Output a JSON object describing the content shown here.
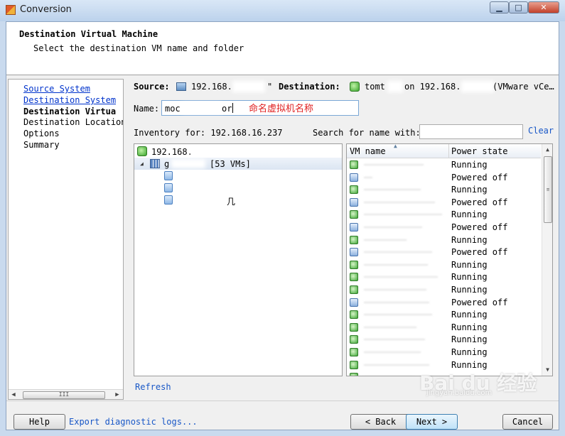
{
  "window": {
    "title": "Conversion",
    "min_glyph": "▁",
    "max_glyph": "□",
    "close_glyph": "✕"
  },
  "header": {
    "title": "Destination Virtual Machine",
    "subtitle": "Select the destination VM name and folder"
  },
  "steps": {
    "items": [
      {
        "label": "Source System",
        "state": "link"
      },
      {
        "label": "Destination System",
        "state": "link"
      },
      {
        "label": "Destination Virtua",
        "state": "current"
      },
      {
        "label": "Destination Location",
        "state": "plain"
      },
      {
        "label": "Options",
        "state": "plain"
      },
      {
        "label": "Summary",
        "state": "plain"
      }
    ],
    "scroll_left": "◀",
    "scroll_right": "▶",
    "scroll_grip": "III"
  },
  "source": {
    "label": "Source:",
    "host": "192.168.",
    "host_suffix": "\""
  },
  "destination": {
    "label": "Destination:",
    "host_prefix": "tomt",
    "host_middle": "on 192.168.",
    "host_suffix": "(VMware vCe…"
  },
  "name": {
    "label": "Name:",
    "value_start": "moc",
    "value_end": "or",
    "annotation": "命名虚拟机名称"
  },
  "inventory": {
    "label": "Inventory for: 192.168.16.237"
  },
  "search": {
    "label": "Search for name with:",
    "value": "",
    "clear": "Clear"
  },
  "tree": {
    "expander": "◢",
    "root": "192.168.",
    "datacenter_prefix": "g",
    "datacenter_count": "[53 VMs]",
    "folder_tail": "几"
  },
  "vm_list": {
    "col_name": "VM name",
    "col_state": "Power state",
    "sort_glyph": "▲",
    "scroll_up": "▲",
    "scroll_down": "▼",
    "scroll_grip": "≡",
    "rows": [
      {
        "state": "Running",
        "icon": "on"
      },
      {
        "state": "Powered off",
        "icon": "off"
      },
      {
        "state": "Running",
        "icon": "on"
      },
      {
        "state": "Powered off",
        "icon": "off"
      },
      {
        "state": "Running",
        "icon": "on"
      },
      {
        "state": "Powered off",
        "icon": "off"
      },
      {
        "state": "Running",
        "icon": "on"
      },
      {
        "state": "Powered off",
        "icon": "off"
      },
      {
        "state": "Running",
        "icon": "on"
      },
      {
        "state": "Running",
        "icon": "on"
      },
      {
        "state": "Running",
        "icon": "on"
      },
      {
        "state": "Powered off",
        "icon": "off"
      },
      {
        "state": "Running",
        "icon": "on"
      },
      {
        "state": "Running",
        "icon": "on"
      },
      {
        "state": "Running",
        "icon": "on"
      },
      {
        "state": "Running",
        "icon": "on"
      },
      {
        "state": "Running",
        "icon": "on"
      },
      {
        "state": "",
        "icon": "on"
      }
    ]
  },
  "refresh": "Refresh",
  "footer": {
    "help": "Help",
    "export": "Export diagnostic logs...",
    "back": "< Back",
    "next": "Next >",
    "cancel": "Cancel"
  },
  "watermark": {
    "main": "Bai du 经验",
    "sub": "jingyan.baidu.com"
  }
}
